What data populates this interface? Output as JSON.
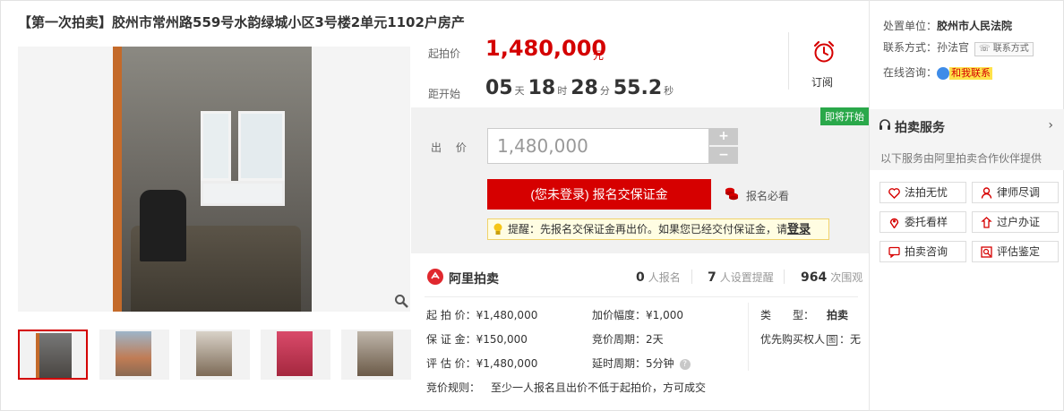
{
  "title": "【第一次拍卖】胶州市常州路559号水韵绿城小区3号楼2单元1102户房产",
  "price": {
    "label": "起拍价",
    "value": "1,480,000",
    "unit": "元"
  },
  "countdown": {
    "label": "距开始",
    "days": "05",
    "days_unit": "天",
    "hours": "18",
    "hours_unit": "时",
    "minutes": "28",
    "minutes_unit": "分",
    "seconds": "55.2",
    "seconds_unit": "秒"
  },
  "subscribe": {
    "label": "订阅"
  },
  "bid": {
    "tag": "即将开始",
    "label": "出 价",
    "input_value": "1,480,000",
    "plus": "+",
    "minus": "−",
    "register_button": "(您未登录) 报名交保证金",
    "must_read": "报名必看",
    "tip_prefix": "提醒：先报名交保证金再出价。如果您已经交付保证金，请",
    "tip_login": "登录"
  },
  "stats": {
    "brand": "阿里拍卖",
    "registered_count": "0",
    "registered_label": "人报名",
    "reminder_count": "7",
    "reminder_label": "人设置提醒",
    "views_count": "964",
    "views_label": "次围观"
  },
  "details": {
    "start_price": "起 拍 价：¥1,480,000",
    "deposit": "保 证 金：¥150,000",
    "appraisal": "评 估 价：¥1,480,000",
    "increment": "加价幅度：¥1,000",
    "period": "竞价周期：2天",
    "extension": "延时周期：5分钟",
    "type_label": "类　　型：",
    "type_value": "拍卖",
    "priority_prefix": "优先购买权人",
    "priority_box": "图",
    "priority_suffix": "：无",
    "rule_label": "竞价规则：",
    "rule_value": "至少一人报名且出价不低于起拍价，方可成交"
  },
  "sidebar": {
    "court_label": "处置单位：",
    "court_value": "胶州市人民法院",
    "contact_label": "联系方式：",
    "contact_value": "孙法官",
    "contact_button": "联系方式",
    "consult_label": "在线咨询：",
    "consult_button": "和我联系",
    "service_title": "拍卖服务",
    "service_sub": "以下服务由阿里拍卖合作伙伴提供",
    "services": [
      "法拍无忧",
      "律师尽调",
      "委托看样",
      "过户办证",
      "拍卖咨询",
      "评估鉴定"
    ]
  },
  "colors": {
    "accent": "#d60000",
    "green_tag": "#2aa84a",
    "tip_bg": "#fffde2"
  }
}
